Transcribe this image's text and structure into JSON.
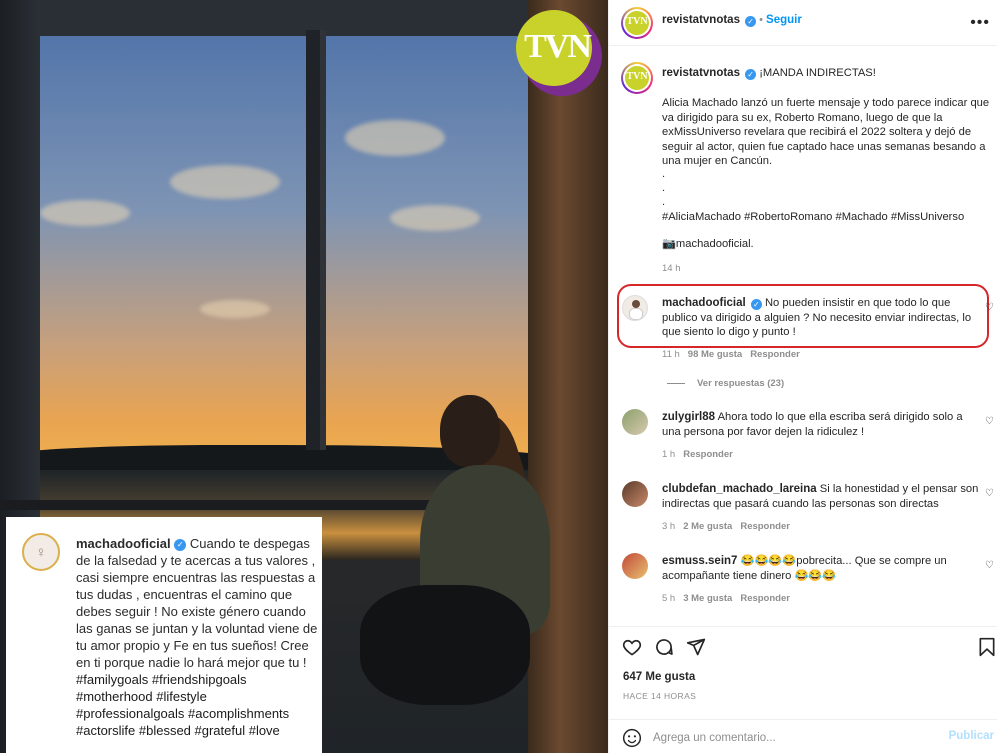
{
  "post": {
    "username": "revistatvnotas",
    "follow_label": "Seguir",
    "more_label": "•••",
    "caption_title": "¡MANDA INDIRECTAS!",
    "caption_body": "Alicia Machado lanzó un fuerte mensaje y todo parece indicar que va dirigido para su ex, Roberto Romano, luego de que la exMissUniverso revelara que recibirá el 2022 soltera y dejó de seguir al actor, quien fue captado hace unas semanas besando a una mujer en Cancún.",
    "caption_dots": [
      ".",
      ".",
      "."
    ],
    "caption_hashtags": "#AliciaMachado #RobertoRomano #Machado #MissUniverso",
    "caption_credit": "📷machadooficial.",
    "caption_time": "14 h"
  },
  "logo_text": "TVN",
  "comments": [
    {
      "username": "machadooficial",
      "verified": true,
      "text": "No pueden insistir en que todo lo que publico va dirigido a alguien ? No necesito enviar indirectas, lo que siento lo digo y punto !",
      "time": "11 h",
      "likes": "98 Me gusta",
      "reply": "Responder",
      "view_replies": "Ver respuestas (23)"
    },
    {
      "username": "zulygirl88",
      "text": "Ahora todo lo que ella escriba será dirigido solo a una persona por favor dejen la ridiculez !",
      "time": "1 h",
      "reply": "Responder"
    },
    {
      "username": "clubdefan_machado_lareina",
      "text": "Si la honestidad y el pensar son indirectas que pasará cuando las personas son directas",
      "time": "3 h",
      "likes": "2 Me gusta",
      "reply": "Responder"
    },
    {
      "username": "esmuss.sein7",
      "text": "😂😂😂😂pobrecita... Que se compre un acompañante tiene dinero 😂😂😂",
      "time": "5 h",
      "likes": "3 Me gusta",
      "reply": "Responder"
    }
  ],
  "overlay": {
    "username": "machadooficial",
    "text": "Cuando te despegas de la falsedad y te acercas a tus valores , casi siempre encuentras las respuestas a tus dudas , encuentras el camino que debes seguir ! No existe género cuando las ganas se juntan y la voluntad viene de tu amor propio y Fe en tus sueños! Cree en ti porque nadie lo hará mejor que tu !",
    "hashtags": "#familygoals #friendshipgoals #motherhood #lifestyle #professionalgoals #acomplishments #actorslife #blessed #grateful #love"
  },
  "actions": {
    "likes": "647 Me gusta",
    "when": "HACE 14 HORAS",
    "comment_placeholder": "Agrega un comentario...",
    "publish_label": "Publicar"
  },
  "icons": {
    "heart": "heart-icon",
    "comment": "comment-icon",
    "share": "share-icon",
    "save": "bookmark-icon",
    "emoji": "emoji-icon",
    "verified": "verified-icon"
  },
  "colors": {
    "link_blue": "#0095f6",
    "verified_blue": "#3897f0",
    "highlight_red": "#d6262a",
    "muted": "#8e8e8e"
  }
}
